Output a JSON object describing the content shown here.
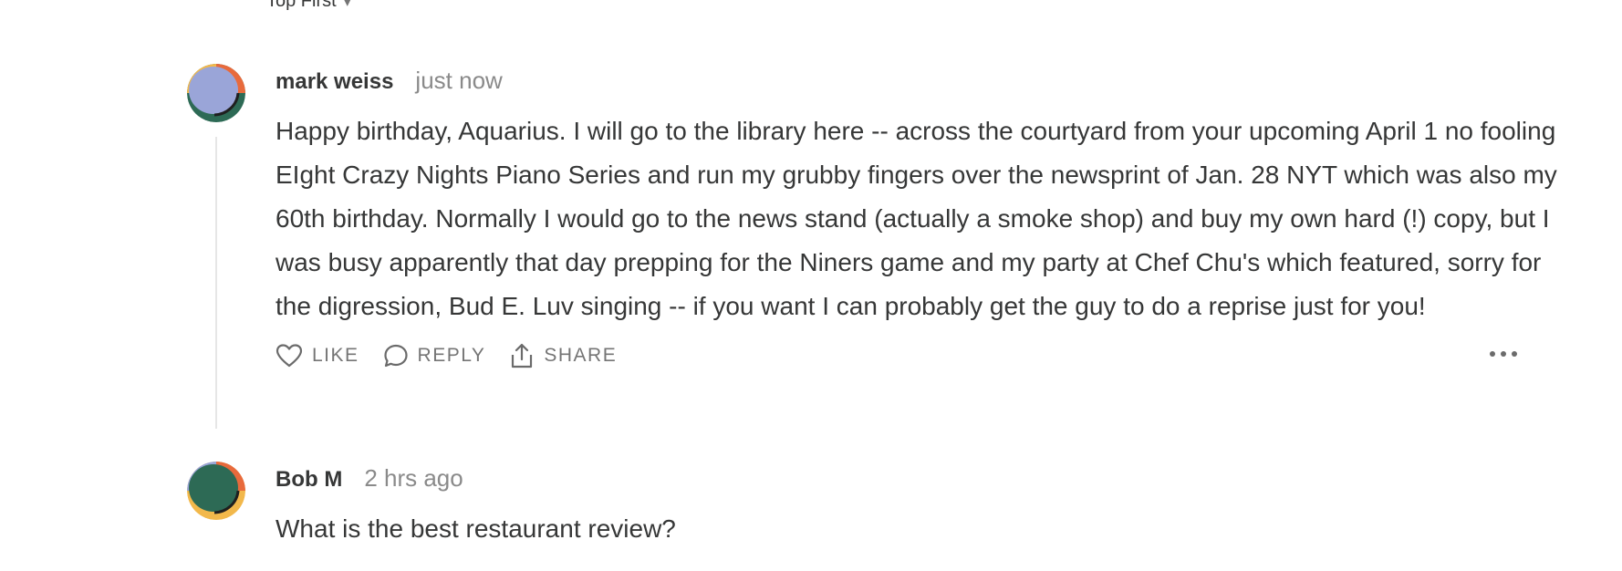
{
  "sort": {
    "label": "Top First"
  },
  "comments": [
    {
      "author": "mark weiss",
      "time": "just now",
      "text": "Happy birthday, Aquarius. I will go to the library here -- across the courtyard from your upcoming April 1 no fooling EIght Crazy Nights Piano Series and run my grubby fingers over the newsprint of Jan. 28 NYT which was also my 60th birthday. Normally I would go to the news stand (actually a smoke shop) and buy my own hard (!) copy, but I was busy apparently that day prepping for the Niners game and my party at Chef Chu's which featured, sorry for the digression, Bud E. Luv singing -- if you want I can probably get the guy to do a reprise just for you!",
      "actions": {
        "like": "LIKE",
        "reply": "REPLY",
        "share": "SHARE"
      },
      "avatar_colors": [
        "#f2b84b",
        "#2d6a55",
        "#e86a3c",
        "#9aa5d8"
      ]
    },
    {
      "author": "Bob M",
      "time": "2 hrs ago",
      "text": "What is the best restaurant review?",
      "avatar_colors": [
        "#f2b84b",
        "#9aa5d8",
        "#e86a3c",
        "#2d6a55"
      ]
    }
  ]
}
